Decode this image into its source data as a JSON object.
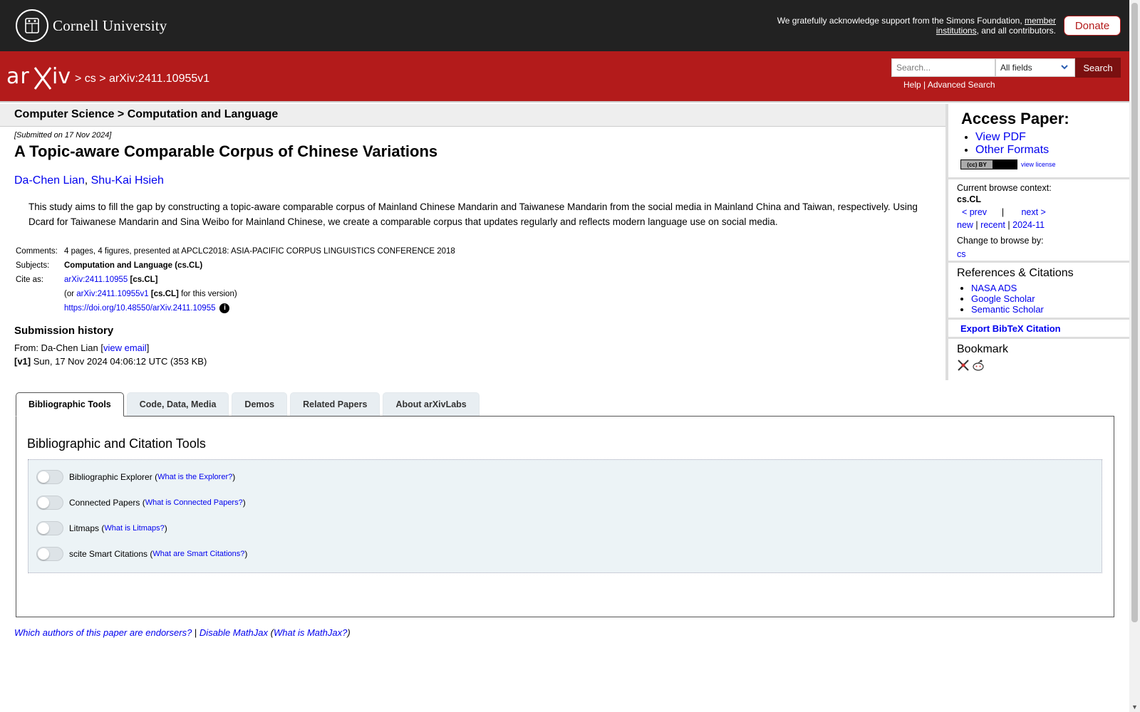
{
  "cornell": {
    "name": "Cornell University",
    "ack_text": "We gratefully acknowledge support from the Simons Foundation, ",
    "ack_link": "member institutions",
    "ack_tail": ", and all contributors.",
    "donate_label": "Donate"
  },
  "header": {
    "logo_text": "arXiv",
    "crumb_sep1": " > ",
    "crumb_cs": "cs",
    "crumb_sep2": " > ",
    "crumb_id": "arXiv:2411.10955v1",
    "search_placeholder": "Search...",
    "search_field": "All fields",
    "search_button": "Search",
    "help": "Help",
    "advanced": "Advanced Search",
    "divider": " | "
  },
  "paper": {
    "subject_header": "Computer Science > Computation and Language",
    "submitted": "[Submitted on 17 Nov 2024]",
    "title": "A Topic-aware Comparable Corpus of Chinese Variations",
    "authors": [
      "Da-Chen Lian",
      "Shu-Kai Hsieh"
    ],
    "author_sep": ", ",
    "abstract": "This study aims to fill the gap by constructing a topic-aware comparable corpus of Mainland Chinese Mandarin and Taiwanese Mandarin from the social media in Mainland China and Taiwan, respectively. Using Dcard for Taiwanese Mandarin and Sina Weibo for Mainland Chinese, we create a comparable corpus that updates regularly and reflects modern language use on social media.",
    "comments_label": "Comments:",
    "comments": "4 pages, 4 figures, presented at APCLC2018: ASIA-PACIFIC CORPUS LINGUISTICS CONFERENCE 2018",
    "subjects_label": "Subjects:",
    "subjects": "Computation and Language (cs.CL)",
    "cite_label": "Cite as:",
    "cite_id": "arXiv:2411.10955",
    "cite_cat": " [cs.CL]",
    "cite_or": "(or ",
    "cite_version": "arXiv:2411.10955v1",
    "cite_version_cat": " [cs.CL]",
    "cite_version_tail": " for this version)",
    "doi": "https://doi.org/10.48550/arXiv.2411.10955",
    "info_glyph": "i"
  },
  "history": {
    "heading": "Submission history",
    "from": "From: Da-Chen Lian [",
    "view_email": "view email",
    "from_close": "]",
    "v1_label": "[v1]",
    "v1_text": " Sun, 17 Nov 2024 04:06:12 UTC (353 KB)"
  },
  "sidebar": {
    "access_heading": "Access Paper:",
    "view_pdf": "View PDF",
    "other_formats": "Other Formats",
    "cc_left": "(cc) BY",
    "view_license": "view license",
    "context_label": "Current browse context:",
    "context_value": "cs.CL",
    "prev": "< prev",
    "pipe": "|",
    "next": "next >",
    "new": "new",
    "recent": "recent",
    "month": "2024-11",
    "change_label": "Change to browse by:",
    "cs": "cs",
    "refs_heading": "References & Citations",
    "refs": [
      "NASA ADS",
      "Google Scholar",
      "Semantic Scholar"
    ],
    "export": "Export BibTeX Citation",
    "bookmark": "Bookmark"
  },
  "tabs": [
    "Bibliographic Tools",
    "Code, Data, Media",
    "Demos",
    "Related Papers",
    "About arXivLabs"
  ],
  "tools": {
    "heading": "Bibliographic and Citation Tools",
    "items": [
      {
        "label": "Bibliographic Explorer",
        "link": "What is the Explorer?"
      },
      {
        "label": "Connected Papers",
        "link": "What is Connected Papers?"
      },
      {
        "label": "Litmaps",
        "link": "What is Litmaps?"
      },
      {
        "label": "scite Smart Citations",
        "link": "What are Smart Citations?"
      }
    ]
  },
  "footer": {
    "endorsers": "Which authors of this paper are endorsers?",
    "sep": " | ",
    "disable_mathjax": "Disable MathJax",
    "mathjax_q": "What is MathJax?"
  },
  "colors": {
    "arxiv_red": "#b31b1b",
    "cornell_dark": "#222222",
    "link_blue": "#0000ee"
  }
}
